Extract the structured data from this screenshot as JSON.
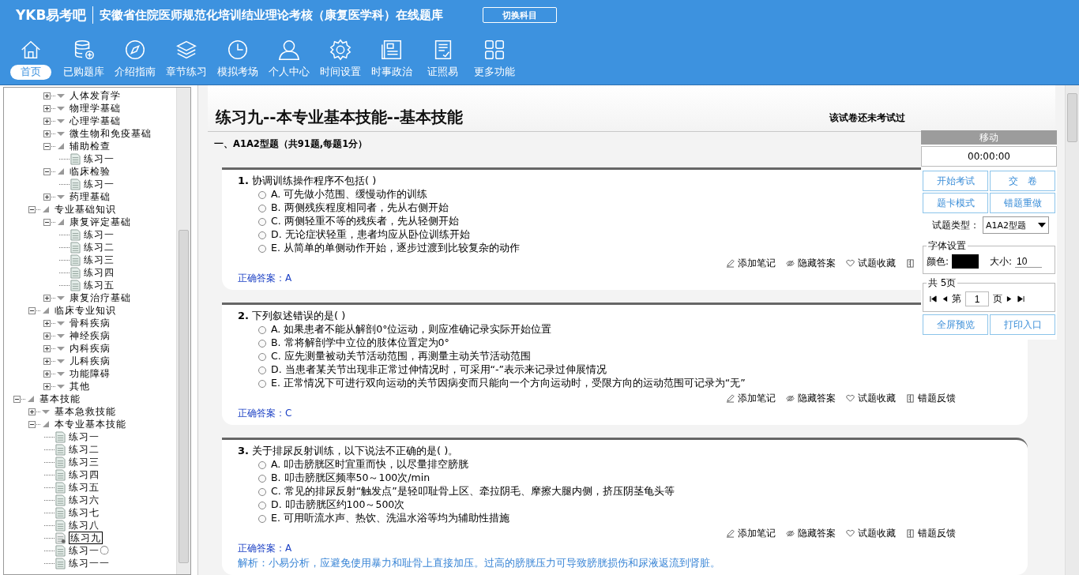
{
  "header": {
    "logo": "YKB易考吧",
    "title": "安徽省住院医师规范化培训结业理论考核（康复医学科）在线题库",
    "switch_button": "切换科目"
  },
  "nav": [
    {
      "label": "首页",
      "selected": true
    },
    {
      "label": "已购题库",
      "selected": false
    },
    {
      "label": "介绍指南",
      "selected": false
    },
    {
      "label": "章节练习",
      "selected": false
    },
    {
      "label": "模拟考场",
      "selected": false
    },
    {
      "label": "个人中心",
      "selected": false
    },
    {
      "label": "时间设置",
      "selected": false
    },
    {
      "label": "时事政治",
      "selected": false
    },
    {
      "label": "证照易",
      "selected": false
    },
    {
      "label": "更多功能",
      "selected": false
    }
  ],
  "tree": {
    "items": [
      {
        "children": [
          {
            "children": [
              {
                "label": "人体发育学",
                "expanded": false
              },
              {
                "label": "物理学基础",
                "expanded": false
              },
              {
                "label": "心理学基础",
                "expanded": false
              },
              {
                "label": "微生物和免疫基础",
                "expanded": false
              },
              {
                "label": "辅助检查",
                "expanded": true,
                "children": [
                  {
                    "label": "练习一",
                    "selected": false
                  }
                ]
              },
              {
                "label": "临床检验",
                "expanded": true,
                "children": [
                  {
                    "label": "练习一",
                    "selected": false
                  }
                ]
              },
              {
                "label": "药理基础",
                "expanded": false
              }
            ]
          },
          {
            "label": "专业基础知识",
            "expanded": true,
            "children": [
              {
                "label": "康复评定基础",
                "expanded": true,
                "children": [
                  {
                    "label": "练习一",
                    "selected": false
                  },
                  {
                    "label": "练习二",
                    "selected": false
                  },
                  {
                    "label": "练习三",
                    "selected": false
                  },
                  {
                    "label": "练习四",
                    "selected": false
                  },
                  {
                    "label": "练习五",
                    "selected": false
                  }
                ]
              },
              {
                "label": "康复治疗基础",
                "expanded": false
              }
            ]
          },
          {
            "label": "临床专业知识",
            "expanded": true,
            "children": [
              {
                "label": "骨科疾病",
                "expanded": false
              },
              {
                "label": "神经疾病",
                "expanded": false
              },
              {
                "label": "内科疾病",
                "expanded": false
              },
              {
                "label": "儿科疾病",
                "expanded": false
              },
              {
                "label": "功能障碍",
                "expanded": false
              },
              {
                "label": "其他",
                "expanded": false
              }
            ]
          }
        ]
      },
      {
        "label": "基本技能",
        "expanded": true,
        "children": [
          {
            "label": "基本急救技能",
            "expanded": false
          },
          {
            "label": "本专业基本技能",
            "expanded": true,
            "children": [
              {
                "label": "练习一",
                "selected": false
              },
              {
                "label": "练习二",
                "selected": false
              },
              {
                "label": "练习三",
                "selected": false
              },
              {
                "label": "练习四",
                "selected": false
              },
              {
                "label": "练习五",
                "selected": false
              },
              {
                "label": "练习六",
                "selected": false
              },
              {
                "label": "练习七",
                "selected": false
              },
              {
                "label": "练习八",
                "selected": false
              },
              {
                "label": "练习九",
                "selected": true
              },
              {
                "label": "练习一〇",
                "selected": false
              },
              {
                "label": "练习一一",
                "selected": false
              }
            ]
          }
        ]
      }
    ]
  },
  "paper": {
    "title": "练习九--本专业基本技能--基本技能",
    "status": "该试卷还未考试过",
    "section": "一、A1A2型题（共91题,每题1分）",
    "questions": [
      {
        "number": "1.",
        "text": "协调训练操作程序不包括( )",
        "options": [
          {
            "text": "A. 可先做小范围、缓慢动作的训练",
            "selected": false
          },
          {
            "text": "B. 两侧残疾程度相同者，先从右侧开始",
            "selected": false
          },
          {
            "text": "C. 两侧轻重不等的残疾者，先从轻侧开始",
            "selected": false
          },
          {
            "text": "D. 无论症状轻重，患者均应从卧位训练开始",
            "selected": false
          },
          {
            "text": "E. 从简单的单侧动作开始，逐步过渡到比较复杂的动作",
            "selected": false
          }
        ],
        "actions": [
          "添加笔记",
          "隐藏答案",
          "试题收藏"
        ],
        "answer": "正确答案：A"
      },
      {
        "number": "2.",
        "text": "下列叙述错误的是( )",
        "options": [
          {
            "text": "A. 如果患者不能从解剖0°位运动，则应准确记录实际开始位置",
            "selected": false
          },
          {
            "text": "B. 常将解剖学中立位的肢体位置定为0°",
            "selected": false
          },
          {
            "text": "C. 应先测量被动关节活动范围，再测量主动关节活动范围",
            "selected": false
          },
          {
            "text": "D. 当患者某关节出现非正常过伸情况时，可采用“-”表示来记录过伸展情况",
            "selected": false
          },
          {
            "text": "E. 正常情况下可进行双向运动的关节因病变而只能向一个方向运动时，受限方向的运动范围可记录为“无”",
            "selected": false
          }
        ],
        "actions": [
          "添加笔记",
          "隐藏答案",
          "试题收藏",
          "错题反馈"
        ],
        "answer": "正确答案：C"
      },
      {
        "number": "3.",
        "text": "关于排尿反射训练，以下说法不正确的是( )。",
        "options": [
          {
            "text": "A. 叩击膀胱区时宜重而快，以尽量排空膀胱",
            "selected": false
          },
          {
            "text": "B. 叩击膀胱区频率50～100次/min",
            "selected": false
          },
          {
            "text": "C. 常见的排尿反射“触发点”是轻叩耻骨上区、牵拉阴毛、摩擦大腿内侧，挤压阴茎龟头等",
            "selected": false
          },
          {
            "text": "D. 叩击膀胱区约100～500次",
            "selected": false
          },
          {
            "text": "E. 可用听流水声、热饮、洗温水浴等均为辅助性措施",
            "selected": false
          }
        ],
        "actions": [
          "添加笔记",
          "隐藏答案",
          "试题收藏",
          "错题反馈"
        ],
        "answer": "正确答案：A",
        "analysis": "解析：小易分析，应避免使用暴力和耻骨上直接加压。过高的膀胱压力可导致膀胱损伤和尿液返流到肾脏。"
      }
    ]
  },
  "tool_panel": {
    "handle": "移动",
    "timer": "00:00:00",
    "buttons": [
      "开始考试",
      "交　卷",
      "题卡模式",
      "错题重做"
    ],
    "type_label": "试题类型：",
    "type_value": "A1A2型题",
    "font_legend": "字体设置",
    "color_label": "颜色:",
    "size_label": "大小:",
    "size_value": "10",
    "pages_legend": "共 5页",
    "page_prefix": "第",
    "page_value": "1",
    "page_suffix": "页",
    "bottom_buttons": [
      "全屏预览",
      "打印入口"
    ]
  }
}
